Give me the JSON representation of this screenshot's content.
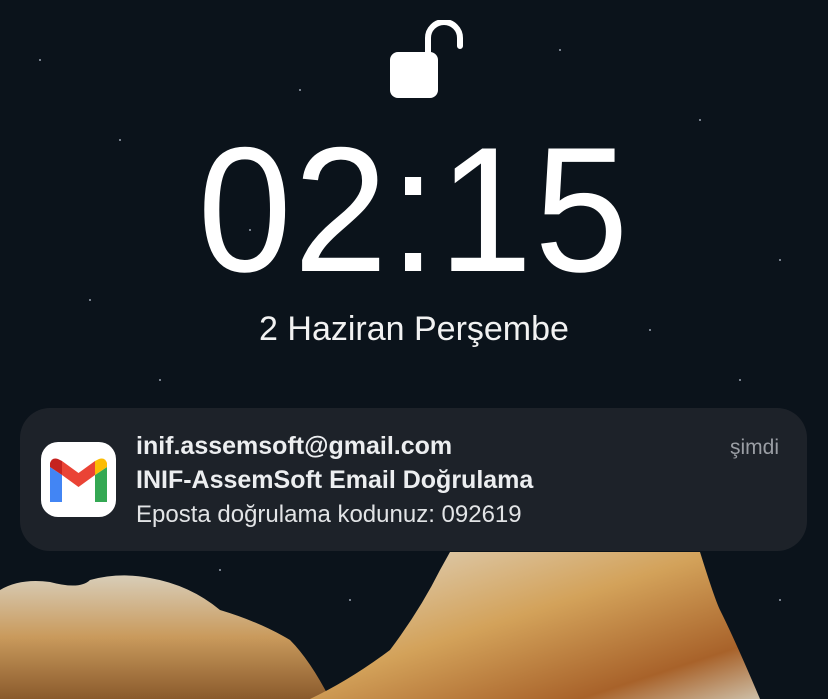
{
  "lockscreen": {
    "lock_icon": "unlocked-padlock-icon",
    "time": "02:15",
    "date": "2 Haziran Perşembe"
  },
  "notification": {
    "app_icon": "gmail-icon",
    "sender": "inif.assemsoft@gmail.com",
    "subject": "INIF-AssemSoft Email Doğrulama",
    "body": "Eposta doğrulama kodunuz: 092619",
    "timestamp": "şimdi"
  },
  "colors": {
    "background": "#0b131b",
    "notification_bg": "#1e232a"
  }
}
